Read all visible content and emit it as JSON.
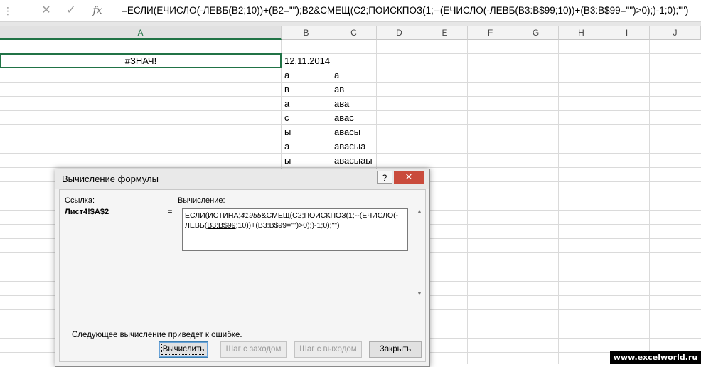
{
  "formula_bar": {
    "cancel_icon": "✕",
    "enter_icon": "✓",
    "fx_label": "fx",
    "formula": "=ЕСЛИ(ЕЧИСЛО(-ЛЕВБ(B2;10))+(B2=\"\");B2&СМЕЩ(C2;ПОИСКПОЗ(1;--(ЕЧИСЛО(-ЛЕВБ(B3:B$99;10))+(B3:B$99=\"\")>0);)-1;0);\"\")"
  },
  "columns": [
    "A",
    "B",
    "C",
    "D",
    "E",
    "F",
    "G",
    "H",
    "I",
    "J"
  ],
  "cells": {
    "A2": "#ЗНАЧ!",
    "B2": "12.11.2014",
    "B_values": [
      "а",
      "в",
      "а",
      "с",
      "ы",
      "а",
      "ы"
    ],
    "C_values": [
      "а",
      "ав",
      "ава",
      "авас",
      "авасы",
      "авасыа",
      "авасыаы"
    ]
  },
  "dialog": {
    "title": "Вычисление формулы",
    "help_label": "?",
    "close_label": "✕",
    "reference_label": "Ссылка:",
    "reference_value": "Лист4!$A$2",
    "equals": "=",
    "evaluation_label": "Вычисление:",
    "evaluation_text": {
      "p1": "ЕСЛИ(ИСТИНА;",
      "p2": "41955",
      "p3": "&СМЕЩ(C2;ПОИСКПОЗ(1;--(ЕЧИСЛО(-ЛЕВБ(",
      "p4": "B3:B$99",
      "p5": ";10))+(B3:B$99=\"\")>0);)-1;0);\"\")"
    },
    "message": "Следующее вычисление приведет к ошибке.",
    "buttons": {
      "evaluate": "Вычислить",
      "step_in": "Шаг с заходом",
      "step_out": "Шаг с выходом",
      "close": "Закрыть"
    }
  },
  "watermark": "www.excelworld.ru",
  "colors": {
    "accent": "#217346",
    "close_button": "#c94b3c"
  }
}
